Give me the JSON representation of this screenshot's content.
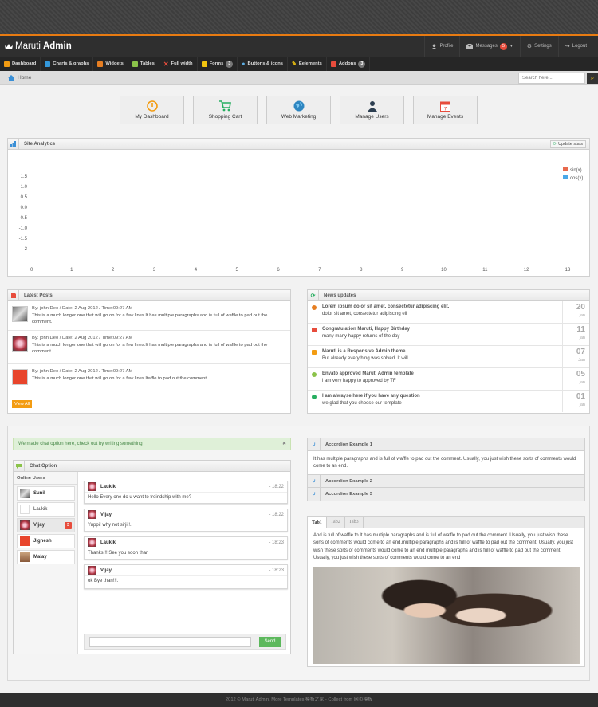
{
  "app": {
    "title_light": "Maruti",
    "title_bold": "Admin"
  },
  "userbar": [
    {
      "label": "Profile",
      "icon": "user-icon"
    },
    {
      "label": "Messages",
      "icon": "envelope-icon",
      "badge": "5"
    },
    {
      "label": "Settings",
      "icon": "gear-icon"
    },
    {
      "label": "Logout",
      "icon": "logout-icon"
    }
  ],
  "nav": [
    {
      "label": "Dashboard",
      "icon": "home-icon",
      "color": "#f39c12"
    },
    {
      "label": "Charts & graphs",
      "icon": "chart-icon",
      "color": "#3498db"
    },
    {
      "label": "Widgets",
      "icon": "widget-icon",
      "color": "#e67e22"
    },
    {
      "label": "Tables",
      "icon": "table-icon",
      "color": "#8bc34a"
    },
    {
      "label": "Full width",
      "icon": "fullwidth-icon",
      "color": "#e74c3c"
    },
    {
      "label": "Forms",
      "icon": "forms-icon",
      "color": "#f1c40f",
      "badge": "3"
    },
    {
      "label": "Buttons & icons",
      "icon": "drop-icon",
      "color": "#3498db"
    },
    {
      "label": "Eelements",
      "icon": "pencil-icon",
      "color": "#f1c40f"
    },
    {
      "label": "Addons",
      "icon": "file-icon",
      "color": "#e74c3c",
      "badge": "3"
    }
  ],
  "breadcrumb": {
    "home": "Home"
  },
  "search": {
    "placeholder": "Search here..."
  },
  "quick_buttons": [
    {
      "label": "My Dashboard",
      "icon": "dashboard-icon",
      "color": "#f39c12"
    },
    {
      "label": "Shopping Cart",
      "icon": "cart-icon",
      "color": "#27ae60"
    },
    {
      "label": "Web Marketing",
      "icon": "globe-icon",
      "color": "#2e86c1"
    },
    {
      "label": "Manage Users",
      "icon": "person-icon",
      "color": "#2c3e50"
    },
    {
      "label": "Manage Events",
      "icon": "calendar-icon",
      "color": "#e74c3c"
    }
  ],
  "analytics": {
    "title": "Site Analytics",
    "update_label": "Update stats"
  },
  "chart_data": {
    "type": "line",
    "x": [
      0,
      1,
      2,
      3,
      4,
      5,
      6,
      7,
      8,
      9,
      10,
      11,
      12,
      13
    ],
    "ylim": [
      -2,
      2
    ],
    "yticks": [
      "1.5",
      "1.0",
      "0.5",
      "0.0",
      "-0.5",
      "-1.0",
      "-1.5",
      "-2"
    ],
    "xticks": [
      "0",
      "1",
      "2",
      "3",
      "4",
      "5",
      "6",
      "7",
      "8",
      "9",
      "10",
      "11",
      "12",
      "13"
    ],
    "series": [
      {
        "name": "sin(x)",
        "color": "#e8694d",
        "values": []
      },
      {
        "name": "cos(x)",
        "color": "#4aa8e8",
        "values": []
      }
    ],
    "legend": "top-right",
    "grid": false
  },
  "latest_posts": {
    "title": "Latest Posts",
    "posts": [
      {
        "meta": "By: john Deo / Date: 2 Aug 2012 / Time:09:27 AM",
        "text": "This is a much longer one that will go on for a few lines.It has multiple paragraphs and is full of waffle to pad out the comment."
      },
      {
        "meta": "By: john Deo / Date: 2 Aug 2012 / Time:09:27 AM",
        "text": "This is a much longer one that will go on for a few lines.It has multiple paragraphs and is full of waffle to pad out the comment."
      },
      {
        "meta": "By: john Deo / Date: 2 Aug 2012 / Time:09:27 AM",
        "text": "This is a much longer one that will go on for a few lines.Itaffle to pad out the comment."
      }
    ],
    "view_all": "View All"
  },
  "news": {
    "title": "News updates",
    "items": [
      {
        "title": "Lorem ipsum dolor sit amet, consectetur adipiscing elit.",
        "text": "dolor sit amet, consectetur adipiscing eli",
        "day": "20",
        "month": "jan",
        "color": "#e67e22"
      },
      {
        "title": "Congratulation Maruti, Happy Birthday",
        "text": "many many happy returns of the day",
        "day": "11",
        "month": "jan",
        "color": "#e74c3c"
      },
      {
        "title": "Maruti is a Responsive Admin theme",
        "text": "But already everything was solved. It will",
        "day": "07",
        "month": "Jan",
        "color": "#f39c12"
      },
      {
        "title": "Envato approved Maruti Admin template",
        "text": "i am very happy to approved by TF",
        "day": "05",
        "month": "jan",
        "color": "#8bc34a"
      },
      {
        "title": "I am alwayse here if you have any question",
        "text": "we glad that you choose our template",
        "day": "01",
        "month": "jan",
        "color": "#27ae60"
      }
    ]
  },
  "chat": {
    "alert": "We made chat option here, check out by writing something",
    "title": "Chat Option",
    "online_title": "Online Users",
    "users": [
      {
        "name": "Sunil"
      },
      {
        "name": "Laukik"
      },
      {
        "name": "Vijay",
        "badge": "3"
      },
      {
        "name": "Jignesh"
      },
      {
        "name": "Malay"
      }
    ],
    "messages": [
      {
        "name": "Laukik",
        "time": "- 18:22",
        "text": "Hello Every one do u want to freindship with me?"
      },
      {
        "name": "Vijay",
        "time": "- 18:22",
        "text": "Yuppi! why not sirji!!."
      },
      {
        "name": "Laukik",
        "time": "- 18:23",
        "text": "Thanks!!! See you soon than"
      },
      {
        "name": "Vijay",
        "time": "- 18:23",
        "text": "ok Bye than!!!."
      }
    ],
    "send_label": "Send"
  },
  "accordion": [
    {
      "title": "Accordion Example 1",
      "body": "It has multiple paragraphs and is full of waffle to pad out the comment. Usually, you just wish these sorts of comments would come to an end."
    },
    {
      "title": "Accordion Example 2"
    },
    {
      "title": "Accordion Example 3"
    }
  ],
  "tabs": {
    "labels": [
      "Tab1",
      "Tab2",
      "Tab3"
    ],
    "content": "And is full of waffle to It has multiple paragraphs and is full of waffle to pad out the comment. Usually, you just wish these sorts of comments would come to an end.multiple paragraphs and is full of waffle to pad out the comment. Usually, you just wish these sorts of comments would come to an end multiple paragraphs and is full of waffle to pad out the comment. Usually, you just wish these sorts of comments would come to an end"
  },
  "footer": "2012 © Maruti Admin. More Templates 模板之家 - Collect from 网页模板"
}
